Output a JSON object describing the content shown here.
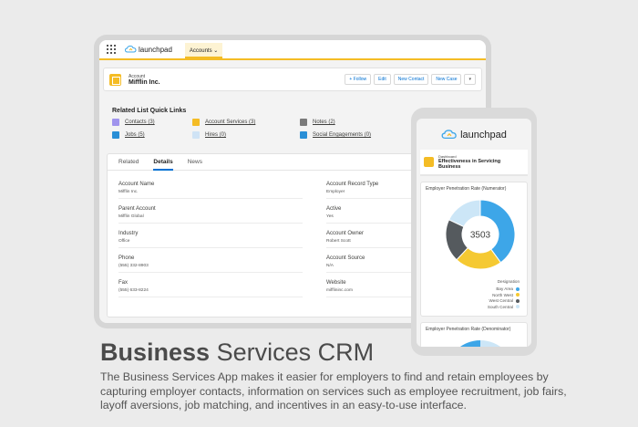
{
  "app": {
    "logo_text": "launchpad",
    "nav_tab": "Accounts",
    "colors": {
      "accent": "#f4bc25",
      "link": "#0070d2"
    }
  },
  "record": {
    "type_label": "Account",
    "name": "Mifflin Inc.",
    "actions": [
      "+ Follow",
      "Edit",
      "New Contact",
      "New Case"
    ]
  },
  "quick_links": {
    "title": "Related List Quick Links",
    "items": [
      {
        "label": "Contacts (3)",
        "icon": "contacts-icon",
        "color": "#a094ed"
      },
      {
        "label": "Account Services (3)",
        "icon": "services-icon",
        "color": "#f4bc25"
      },
      {
        "label": "Notes (2)",
        "icon": "notes-icon",
        "color": "#7a7a7a"
      },
      {
        "label": "Jobs (5)",
        "icon": "jobs-icon",
        "color": "#2a8fd6"
      },
      {
        "label": "Hires (0)",
        "icon": "hires-icon",
        "color": "#cfe3f5"
      },
      {
        "label": "Social Engagements (0)",
        "icon": "social-icon",
        "color": "#2a8fd6"
      }
    ]
  },
  "details": {
    "tabs": [
      "Related",
      "Details",
      "News"
    ],
    "left_fields": [
      {
        "label": "Account Name",
        "value": "Mifflin Inc."
      },
      {
        "label": "Parent Account",
        "value": "Mifflin Global"
      },
      {
        "label": "Industry",
        "value": "Office"
      },
      {
        "label": "Phone",
        "value": "(555) 332-8903"
      },
      {
        "label": "Fax",
        "value": "(555) 633-8224"
      }
    ],
    "right_fields": [
      {
        "label": "Account Record Type",
        "value": "Employer"
      },
      {
        "label": "Active",
        "value": "Yes"
      },
      {
        "label": "Account Owner",
        "value": "Robert Scott"
      },
      {
        "label": "Account Source",
        "value": "N/A"
      },
      {
        "label": "Website",
        "value": "mifflininc.com"
      }
    ]
  },
  "phone": {
    "logo_text": "launchpad",
    "dashboard_type": "Dashboard",
    "dashboard_title": "Effectiveness in Servicing Business",
    "chart2_title": "Employer Penetration Rate (Denominator)"
  },
  "chart_data": {
    "type": "pie",
    "title": "Employer Penetration Rate (Numerator)",
    "center_label": "3503",
    "legend_title": "Designation",
    "series": [
      {
        "name": "Bay Area",
        "value": 40,
        "color": "#3da6e8"
      },
      {
        "name": "North West",
        "value": 22,
        "color": "#f5c932"
      },
      {
        "name": "West Central",
        "value": 20,
        "color": "#555a5e"
      },
      {
        "name": "South Central",
        "value": 18,
        "color": "#cce6f7"
      }
    ]
  },
  "marketing": {
    "headline_bold": "Business",
    "headline_rest": " Services CRM",
    "description": "The Business Services App makes it easier for employers to find and retain employees by capturing employer contacts, information on services such as employee recruitment, job fairs, layoff aversions, job matching, and incentives in an easy-to-use interface."
  }
}
